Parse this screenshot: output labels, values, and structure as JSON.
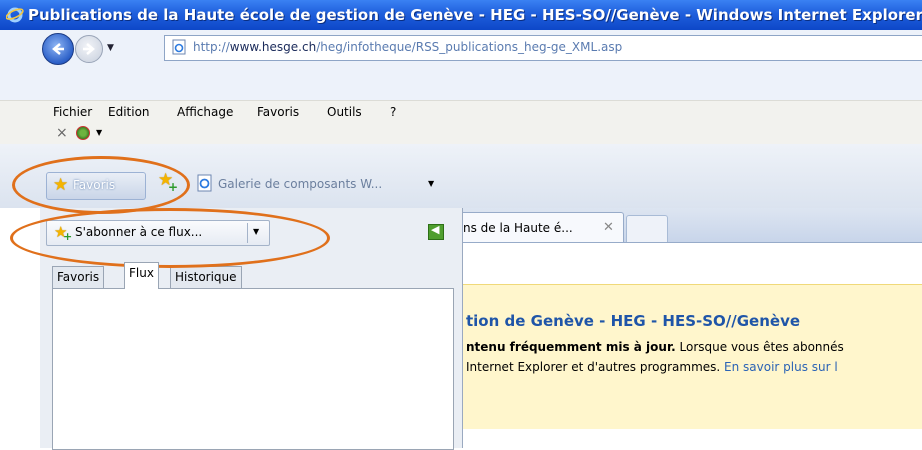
{
  "window": {
    "title": "Publications de la Haute école de gestion de Genève - HEG - HES-SO//Genève - Windows Internet Explorer"
  },
  "address_bar": {
    "url_prefix": "http://",
    "url_host": "www.hesge.ch",
    "url_path": "/heg/infotheque/RSS_publications_heg-ge_XML.asp"
  },
  "menu": {
    "items": [
      "Fichier",
      "Edition",
      "Affichage",
      "Favoris",
      "Outils",
      "?"
    ]
  },
  "favorites_bar": {
    "favorites_label": "Favoris",
    "gallery_label": "Galerie de composants W..."
  },
  "tabs": [
    {
      "label": "ns de la Haute é...",
      "active": true
    }
  ],
  "favorites_panel": {
    "subscribe_label": "S'abonner à ce flux...",
    "tabs": [
      "Favoris",
      "Flux",
      "Historique"
    ],
    "selected_tab": "Flux"
  },
  "content": {
    "feed_title": "tion de Genève - HEG - HES-SO//Genève",
    "line1_bold": "ntenu fréquemment mis à jour.",
    "line1_rest": " Lorsque vous êtes abonnés",
    "line2_text": "Internet Explorer et d'autres programmes. ",
    "line2_link": "En savoir plus sur l"
  },
  "colors": {
    "annotation": "#e0701b",
    "titlebar": "#1f5fdc",
    "feed_band": "#fff6cc"
  }
}
